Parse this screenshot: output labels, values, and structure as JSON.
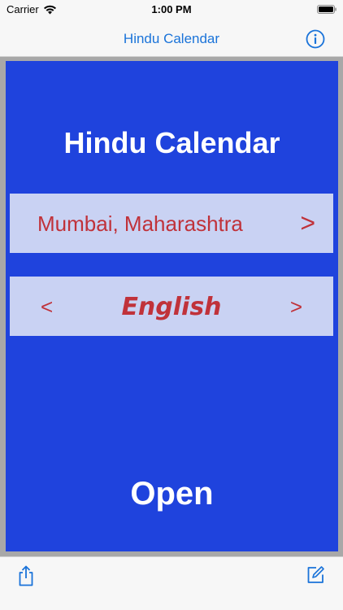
{
  "status_bar": {
    "carrier": "Carrier",
    "time": "1:00 PM",
    "wifi_icon": "wifi-icon",
    "battery_icon": "battery-icon"
  },
  "nav_bar": {
    "title": "Hindu Calendar",
    "info_icon": "info-icon"
  },
  "main": {
    "title": "Hindu Calendar",
    "location": {
      "label": "Mumbai, Maharashtra",
      "next": ">"
    },
    "language": {
      "prev": "<",
      "label": "English",
      "next": ">"
    },
    "open_label": "Open"
  },
  "toolbar": {
    "share_icon": "share-icon",
    "compose_icon": "compose-icon"
  },
  "colors": {
    "accent": "#1a73d9",
    "panel_blue": "#1f43dd",
    "row_bg": "#c9d2f3",
    "row_text": "#c0323a"
  }
}
